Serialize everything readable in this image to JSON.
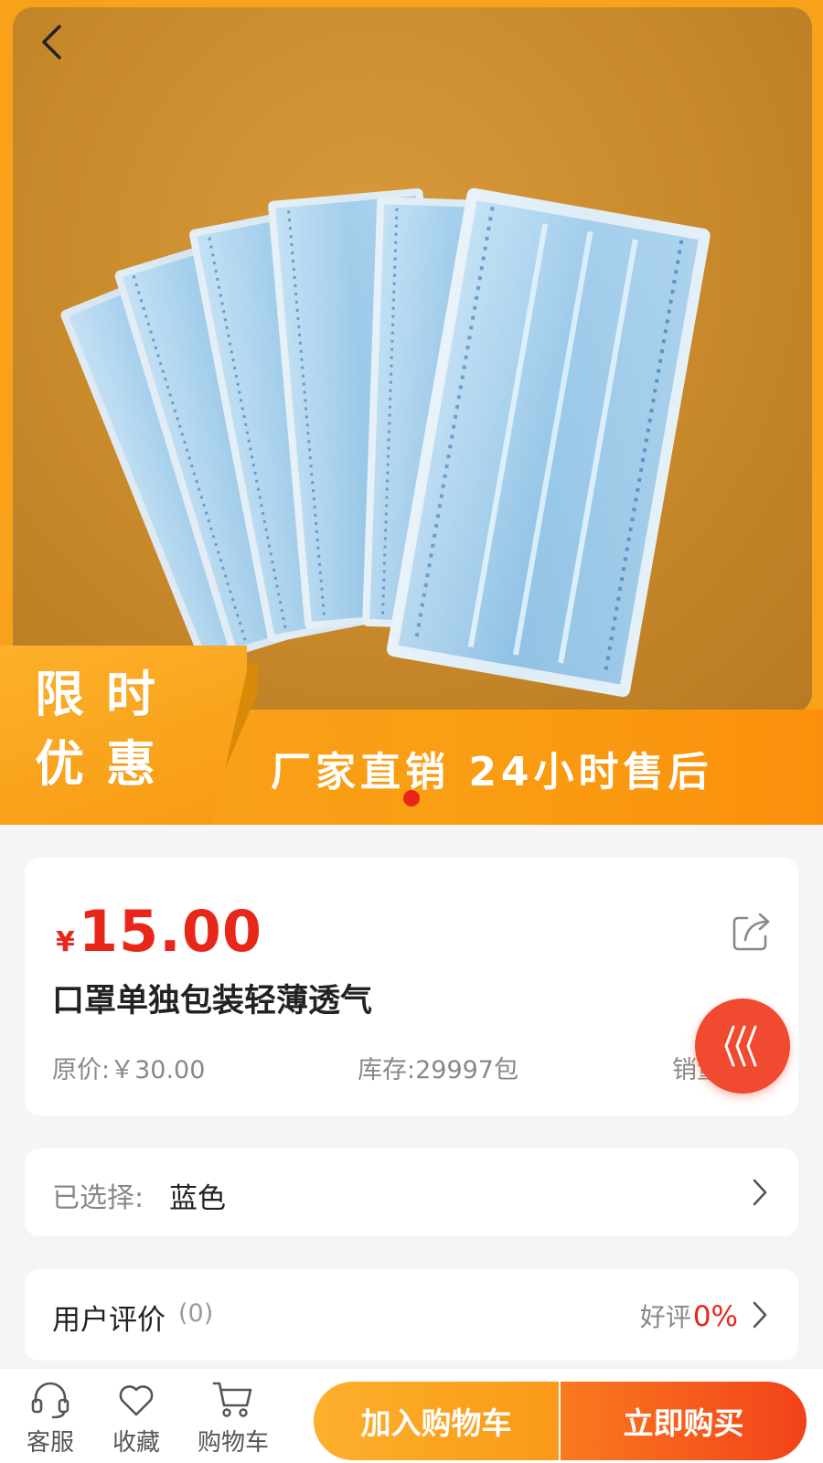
{
  "colors": {
    "accent_orange": "#f7a21a",
    "price_red": "#e8271a",
    "buy_red": "#f2421a",
    "float_button": "#f04a30"
  },
  "header": {
    "back_icon": "chevron-left-icon"
  },
  "hero": {
    "image_subject": "product photo of individually packaged blue face masks",
    "promo_tag_line1": "限时",
    "promo_tag_line2": "优惠",
    "promo_slogan": "厂家直销 24小时售后",
    "carousel_active_index": 1,
    "carousel_total": 1
  },
  "product": {
    "currency_symbol": "¥",
    "price": "15.00",
    "title": "口罩单独包装轻薄透气",
    "original_price": "原价:￥30.00",
    "stock": "库存:29997包",
    "sales": "销量",
    "share_icon": "share-icon"
  },
  "float_button": {
    "icon": "wave-lines-icon"
  },
  "spec": {
    "label": "已选择:",
    "value": "蓝色"
  },
  "reviews": {
    "label": "用户评价",
    "count": "(0)",
    "rate_label": "好评",
    "rate_value": "0%"
  },
  "bottom_bar": {
    "service_label": "客服",
    "favorite_label": "收藏",
    "cart_label": "购物车",
    "add_to_cart_label": "加入购物车",
    "buy_now_label": "立即购买"
  }
}
